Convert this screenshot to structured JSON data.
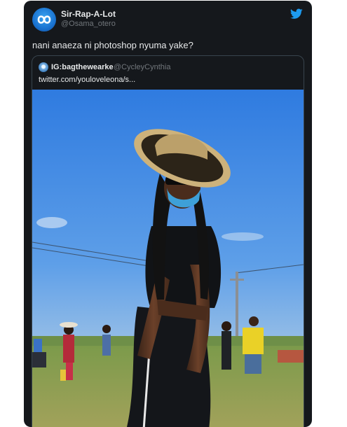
{
  "tweet": {
    "author_name": "Sir-Rap-A-Lot",
    "author_handle": "@Osama_otero",
    "text": "nani anaeza ni photoshop nyuma yake?",
    "platform_icon": "twitter-bird-icon"
  },
  "quoted_tweet": {
    "author_name": "IG:bagthewearke",
    "author_handle": "@CycleyCynthia",
    "link_text": "twitter.com/youloveleona/s..."
  },
  "colors": {
    "card_background": "#15181c",
    "twitter_blue": "#1d9bf0",
    "text_primary": "#e7e9ea",
    "text_secondary": "#71767b"
  }
}
